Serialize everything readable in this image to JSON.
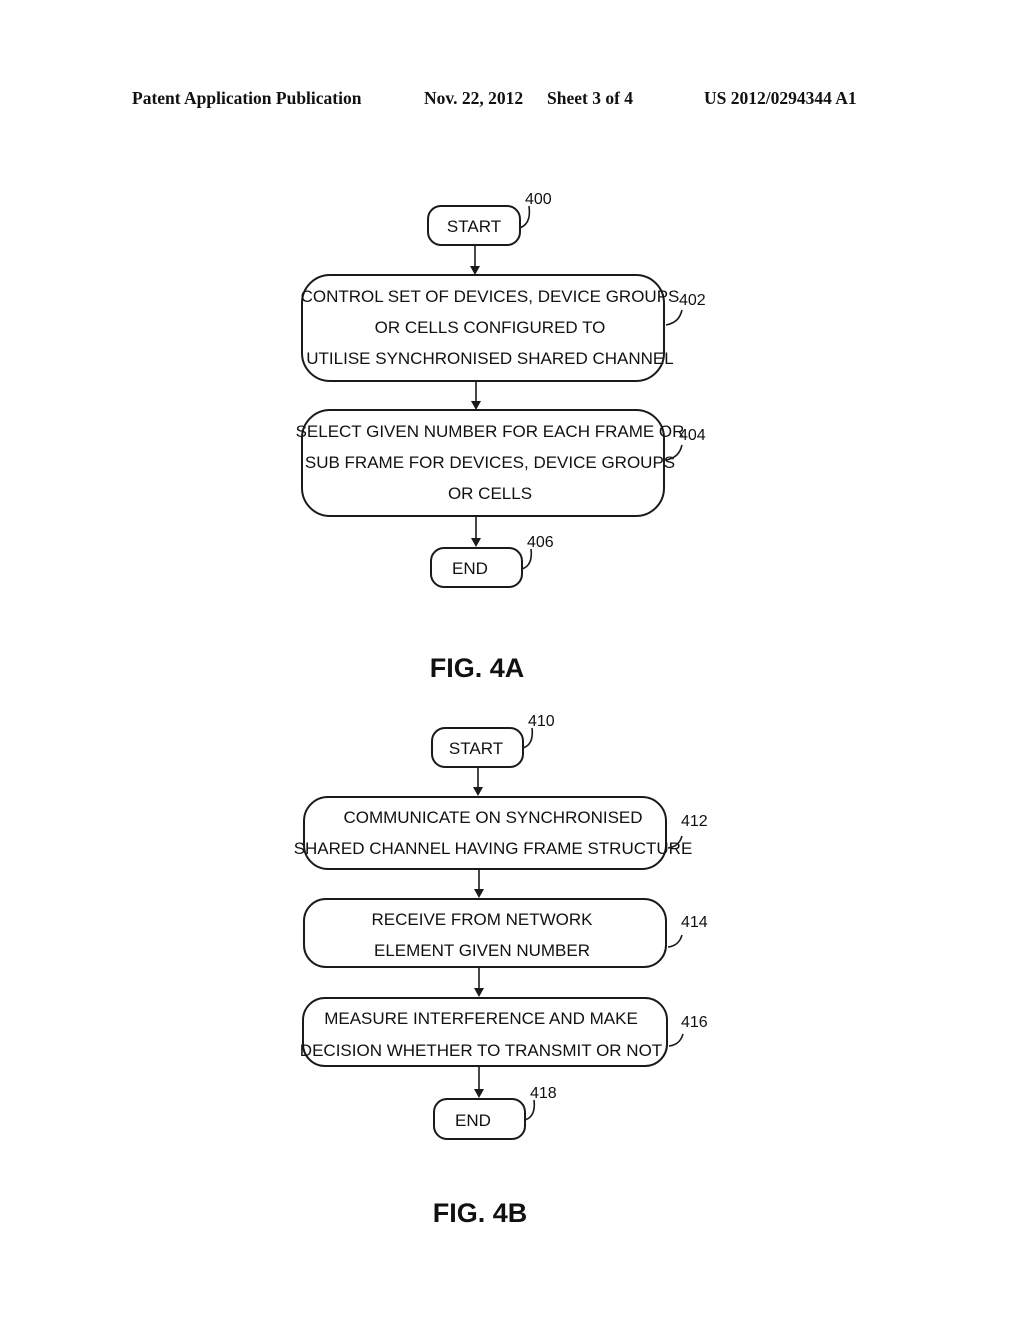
{
  "header": {
    "publication": "Patent Application Publication",
    "date": "Nov. 22, 2012",
    "sheet": "Sheet 3 of 4",
    "number": "US 2012/0294344 A1"
  },
  "fig4a": {
    "caption": "FIG. 4A",
    "start": {
      "ref": "400",
      "label": "START"
    },
    "steps": [
      {
        "ref": "402",
        "lines": [
          "CONTROL SET OF DEVICES, DEVICE GROUPS",
          "OR CELLS CONFIGURED TO",
          "UTILISE SYNCHRONISED SHARED CHANNEL"
        ]
      },
      {
        "ref": "404",
        "lines": [
          "SELECT GIVEN NUMBER FOR EACH FRAME OR",
          "SUB FRAME FOR DEVICES, DEVICE GROUPS",
          "OR CELLS"
        ]
      }
    ],
    "end": {
      "ref": "406",
      "label": "END"
    }
  },
  "fig4b": {
    "caption": "FIG. 4B",
    "start": {
      "ref": "410",
      "label": "START"
    },
    "steps": [
      {
        "ref": "412",
        "lines": [
          "COMMUNICATE ON SYNCHRONISED",
          "SHARED CHANNEL HAVING FRAME STRUCTURE"
        ]
      },
      {
        "ref": "414",
        "lines": [
          "RECEIVE FROM NETWORK",
          "ELEMENT GIVEN NUMBER"
        ]
      },
      {
        "ref": "416",
        "lines": [
          "MEASURE INTERFERENCE AND MAKE",
          "DECISION WHETHER TO TRANSMIT OR NOT"
        ]
      }
    ],
    "end": {
      "ref": "418",
      "label": "END"
    }
  }
}
